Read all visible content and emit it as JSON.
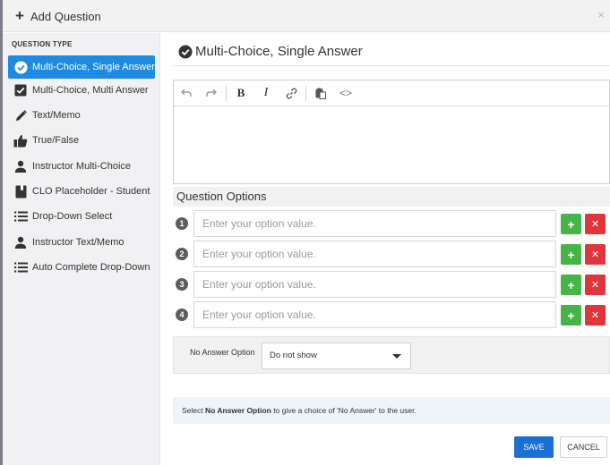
{
  "header": {
    "title": "Add Question",
    "plus_glyph": "+",
    "close_glyph": "×"
  },
  "sidebar": {
    "heading": "QUESTION TYPE",
    "items": [
      {
        "label": "Multi-Choice, Single Answer",
        "icon": "check-circle-icon",
        "active": true
      },
      {
        "label": "Multi-Choice, Multi Answer",
        "icon": "check-square-icon",
        "active": false
      },
      {
        "label": "Text/Memo",
        "icon": "pencil-icon",
        "active": false
      },
      {
        "label": "True/False",
        "icon": "thumbs-up-icon",
        "active": false
      },
      {
        "label": "Instructor Multi-Choice",
        "icon": "person-icon",
        "active": false
      },
      {
        "label": "CLO Placeholder - Student",
        "icon": "book-icon",
        "active": false
      },
      {
        "label": "Drop-Down Select",
        "icon": "list-icon",
        "active": false
      },
      {
        "label": "Instructor Text/Memo",
        "icon": "person-icon",
        "active": false
      },
      {
        "label": "Auto Complete Drop-Down",
        "icon": "list-icon",
        "active": false
      }
    ]
  },
  "main": {
    "title": "Multi-Choice, Single Answer",
    "title_icon": "check-circle-icon",
    "toolbar": [
      "undo-icon",
      "redo-icon",
      "bold-icon",
      "italic-icon",
      "link-icon",
      "paste-icon",
      "code-icon"
    ],
    "toolbar_text": {
      "bold": "B",
      "italic": "I",
      "code": "<>"
    },
    "options_heading": "Question Options",
    "options": [
      {
        "number": "1",
        "placeholder": "Enter your option value.",
        "value": ""
      },
      {
        "number": "2",
        "placeholder": "Enter your option value.",
        "value": ""
      },
      {
        "number": "3",
        "placeholder": "Enter your option value.",
        "value": ""
      },
      {
        "number": "4",
        "placeholder": "Enter your option value.",
        "value": ""
      }
    ],
    "add_glyph": "+",
    "remove_glyph": "✕",
    "no_answer": {
      "label": "No Answer Option",
      "selected": "Do not show"
    },
    "info": {
      "prefix": "Select ",
      "bold": "No Answer Option",
      "suffix": " to give a choice of 'No Answer' to the user."
    },
    "save_label": "SAVE",
    "cancel_label": "CANCEL"
  },
  "colors": {
    "accent": "#1f8be0",
    "add": "#46b447",
    "remove": "#e0353b",
    "save": "#1a6fd2"
  }
}
